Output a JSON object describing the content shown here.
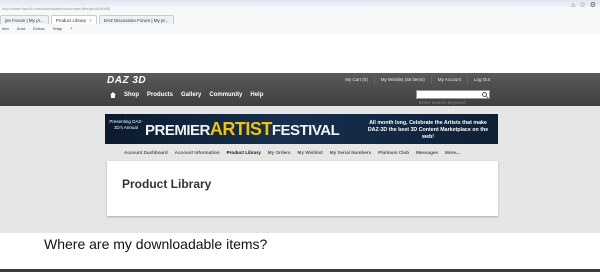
{
  "browser": {
    "url": "http://www.daz3d.com/downloader/customer/files/prod/18465",
    "window_buttons": [
      "⌂",
      "☆",
      "⚙"
    ],
    "tabs": [
      {
        "label": "jen Forum | My pr..."
      },
      {
        "label": "Product Library",
        "active": true
      },
      {
        "label": "DAZ Discussion Forum | My pr..."
      }
    ],
    "favorites": [
      "rten",
      "Annt",
      "Extras",
      "Tetay",
      "?"
    ]
  },
  "site": {
    "logo": "DAZ 3D",
    "account_links": [
      "My Cart (0)",
      "My Wishlist (45 items)",
      "My Account",
      "Log Out"
    ],
    "nav": [
      "Shop",
      "Products",
      "Gallery",
      "Community",
      "Help"
    ],
    "search_placeholder": "Enter search keyword",
    "banner": {
      "presenting": "Presenting DAZ-3D's Annual",
      "title_premier": "PREMIER",
      "title_artist": "ARTIST",
      "title_festival": "FESTIVAL",
      "tagline": "All month long, Celebrate the Artists that make DAZ-3D the best 3D Content Marketplace on the web!"
    },
    "subnav": [
      {
        "label": "Account Dashboard"
      },
      {
        "label": "Account Information"
      },
      {
        "label": "Product Library",
        "active": true
      },
      {
        "label": "My Orders"
      },
      {
        "label": "My Wishlist"
      },
      {
        "label": "My Serial Numbers"
      },
      {
        "label": "Platinum Club"
      },
      {
        "label": "Messages"
      },
      {
        "label": "More..."
      }
    ],
    "page_title": "Product Library"
  },
  "caption": "Where are my downloadable items?"
}
